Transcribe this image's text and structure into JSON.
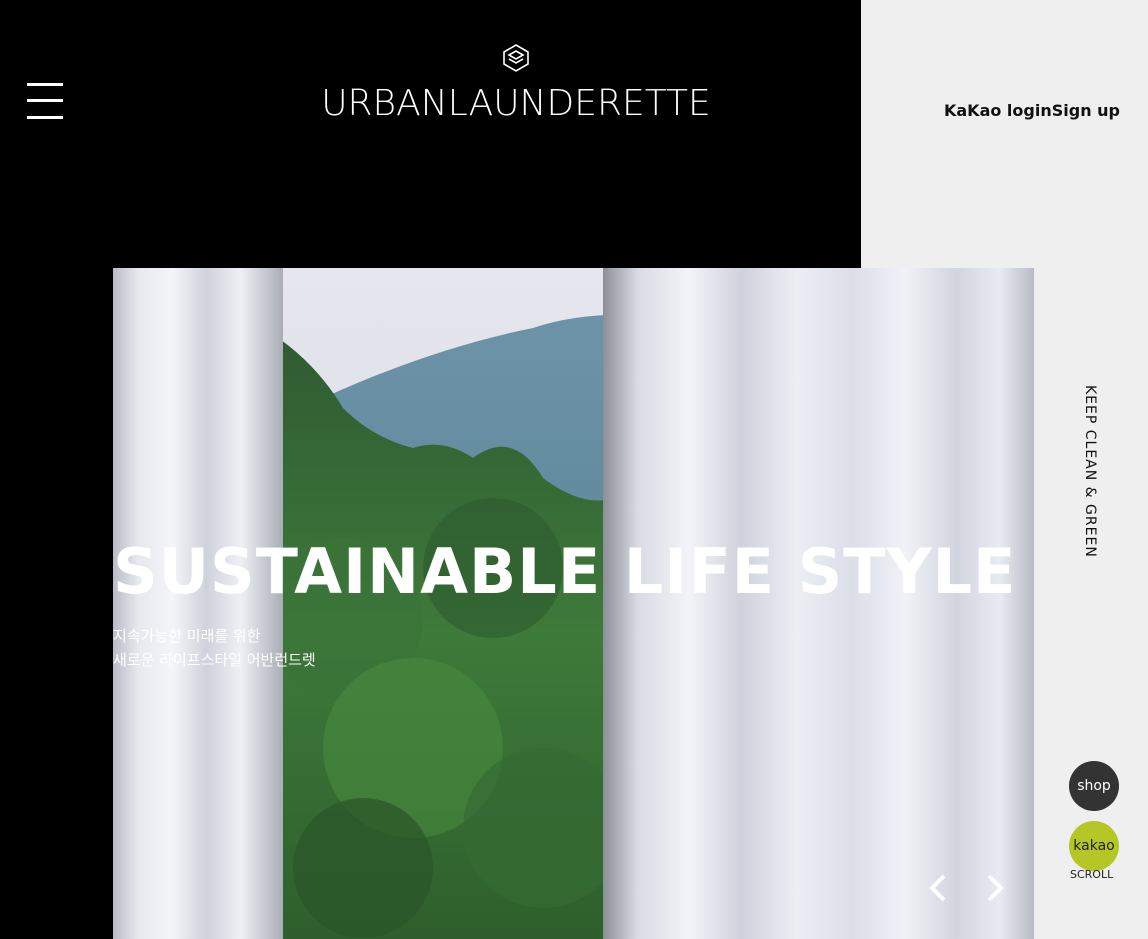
{
  "header": {
    "brand": "URBANLAUNDERETTE",
    "menu_icon": "hamburger-menu-icon",
    "logo_icon": "layered-diamond-logo-icon",
    "auth": {
      "kakao_login": "KaKao login",
      "sign_up": "Sign up"
    }
  },
  "hero": {
    "title": "SUSTAINABLE LIFE STYLE",
    "subtitle_line1": "지속가능한 미래를 위한",
    "subtitle_line2": "새로운 라이프스타일 어반런드렛",
    "prev_icon": "chevron-left-icon",
    "next_icon": "chevron-right-icon"
  },
  "side": {
    "tagline": "KEEP CLEAN & GREEN",
    "shop_label": "shop",
    "kakao_label": "kakao",
    "scroll_label": "SCROLL"
  },
  "colors": {
    "panel": "#000000",
    "background": "#efefef",
    "shop_circle": "#333333",
    "kakao_circle": "#b5c726"
  }
}
